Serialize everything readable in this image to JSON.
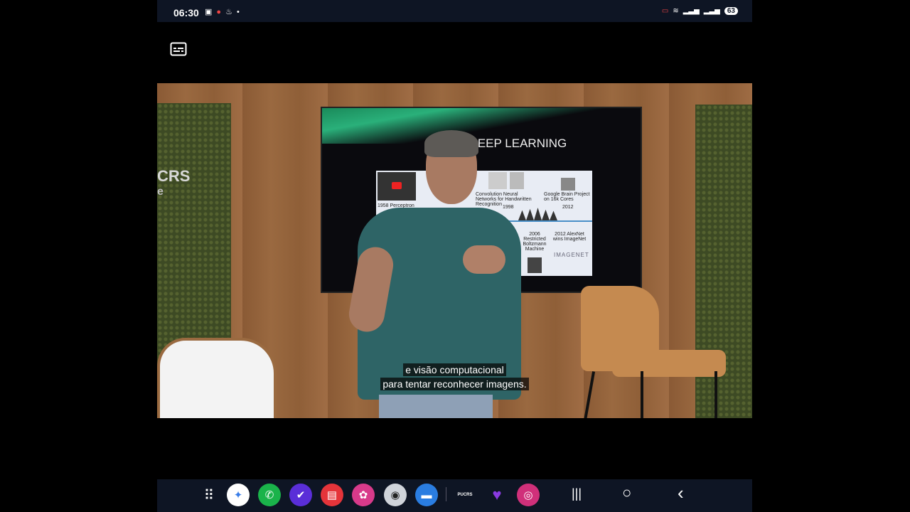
{
  "status_bar": {
    "time": "06:30",
    "battery": "63",
    "notification_icons": [
      "screenshot-icon",
      "record-icon",
      "flame-icon",
      "dot-icon"
    ],
    "system_icons": [
      "cast-icon",
      "wifi-icon",
      "signal-icon",
      "signal-icon"
    ]
  },
  "video": {
    "wall_logo": "CRS",
    "wall_logo_sub": "e",
    "slide_title": "UMO A DEEP LEARNING",
    "slide": {
      "item_1958": "1958  Perceptron",
      "item_1998_title": "Convolution Neural Networks for Handwritten Recognition",
      "item_1998_year": "1998",
      "item_2012_top": "Google Brain Project on 16k Cores",
      "item_2012_top_year": "2012",
      "item_2006": "2006 Restricted Boltzmann Machine",
      "item_2012_bottom": "2012 AlexNet wins ImageNet",
      "imagenet": "IMAGENET"
    },
    "captions": [
      "e visão computacional",
      "para tentar reconhecer imagens."
    ]
  },
  "dock": {
    "apps": [
      {
        "name": "apps-grid-icon",
        "glyph": "⠿",
        "bg": "transparent"
      },
      {
        "name": "gemini-icon",
        "glyph": "✦",
        "bg": "#ffffff"
      },
      {
        "name": "phone-icon",
        "glyph": "✆",
        "bg": "#1ab34a"
      },
      {
        "name": "tasks-icon",
        "glyph": "✔",
        "bg": "#5a2ed8"
      },
      {
        "name": "notes-icon",
        "glyph": "▤",
        "bg": "#e5343a"
      },
      {
        "name": "gallery-icon",
        "glyph": "✿",
        "bg": "#d83a8a"
      },
      {
        "name": "camera-icon",
        "glyph": "◉",
        "bg": "#cfd3da"
      },
      {
        "name": "messages-icon",
        "glyph": "▬",
        "bg": "#2a7de1"
      },
      {
        "name": "pucrs-online-icon",
        "glyph": "PUCRS",
        "bg": "#0e1524"
      },
      {
        "name": "heart-app-icon",
        "glyph": "♥",
        "bg": "transparent"
      },
      {
        "name": "instagram-icon",
        "glyph": "◎",
        "bg": "#d0307a"
      }
    ],
    "nav": {
      "recents": "|||",
      "home": "○",
      "back": "‹"
    }
  }
}
